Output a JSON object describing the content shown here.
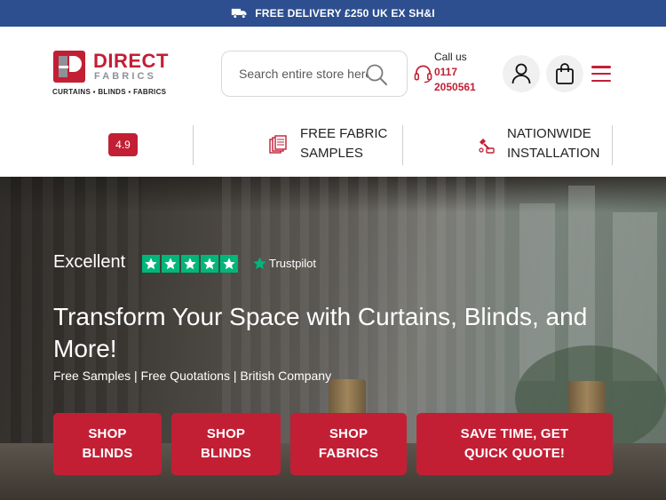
{
  "topbar": {
    "icon": "truck-icon",
    "text": "FREE DELIVERY £250 UK EX SH&I"
  },
  "brand": {
    "name_primary": "DIRECT",
    "name_secondary": "FABRICS",
    "tagline": "CURTAINS ▪ BLINDS ▪ FABRICS",
    "color": "#c21f35"
  },
  "search": {
    "placeholder": "Search entire store here..."
  },
  "contact": {
    "label": "Call us",
    "phone": "0117 2050561"
  },
  "icons": {
    "account": "user-icon",
    "cart": "shopping-bag-icon",
    "menu": "hamburger-menu-icon"
  },
  "usp": {
    "rating": "4.9",
    "items": [
      {
        "label": "FREE FABRIC\nSAMPLES",
        "icon": "fabric-swatch-icon"
      },
      {
        "label": "NATIONWIDE\nINSTALLATION",
        "icon": "installation-icon"
      }
    ]
  },
  "hero": {
    "trustpilot": {
      "rating_word": "Excellent",
      "stars": 5,
      "brand": "Trustpilot",
      "star_color": "#00b67a"
    },
    "title": "Transform Your Space with Curtains, Blinds, and More!",
    "subtitle": "Free Samples | Free Quotations | British Company",
    "ctas": [
      {
        "label": "SHOP\nBLINDS"
      },
      {
        "label": "SHOP\nBLINDS"
      },
      {
        "label": "SHOP\nFABRICS"
      },
      {
        "label": "SAVE TIME, GET\nQUICK QUOTE!"
      }
    ]
  },
  "colors": {
    "topbar": "#2d4f8f",
    "accent": "#c21f35",
    "trustpilot": "#00b67a"
  }
}
